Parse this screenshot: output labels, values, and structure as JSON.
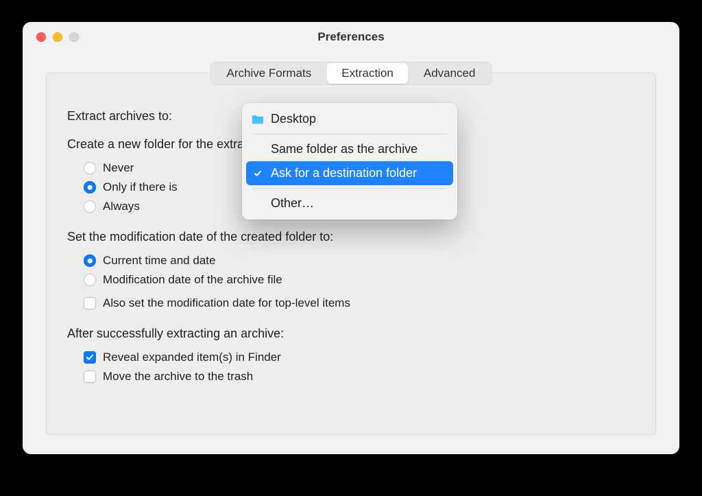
{
  "window": {
    "title": "Preferences"
  },
  "tabs": {
    "items": [
      {
        "label": "Archive Formats",
        "active": false
      },
      {
        "label": "Extraction",
        "active": true
      },
      {
        "label": "Advanced",
        "active": false
      }
    ]
  },
  "extract_to_label": "Extract archives to:",
  "dropdown": {
    "desktop": "Desktop",
    "same_folder": "Same folder as the archive",
    "ask": "Ask for a destination folder",
    "other": "Other…",
    "selected": "ask"
  },
  "create_folder": {
    "label": "Create a new folder for the extracted files:",
    "never": "Never",
    "only_if": "Only if there is more than one top-level item",
    "always": "Always",
    "selected": "only_if"
  },
  "mod_date": {
    "label": "Set the modification date of the created folder to:",
    "current": "Current time and date",
    "archive": "Modification date of the archive file",
    "also_top": "Also set the modification date for top-level items",
    "selected": "current",
    "also_top_checked": false
  },
  "after_extract": {
    "label": "After successfully extracting an archive:",
    "reveal": "Reveal expanded item(s) in Finder",
    "trash": "Move the archive to the trash",
    "reveal_checked": true,
    "trash_checked": false
  }
}
